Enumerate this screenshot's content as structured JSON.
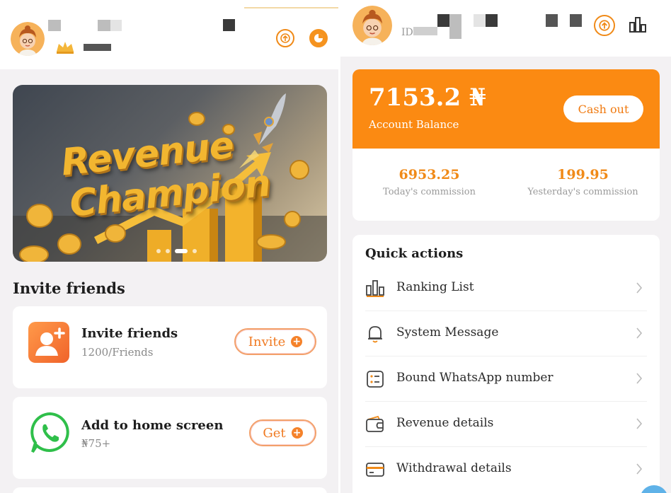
{
  "left": {
    "banner": {
      "line1": "Revenue",
      "line2": "Champion",
      "slide_count": 4,
      "active_slide": 3
    },
    "section_title": "Invite friends",
    "cards": [
      {
        "title": "Invite friends",
        "subtitle": "1200/Friends",
        "button": "Invite",
        "icon": "add-user-icon"
      },
      {
        "title": "Add to home screen",
        "subtitle": "₦75+",
        "button": "Get",
        "icon": "whatsapp-icon"
      }
    ]
  },
  "right": {
    "header": {
      "id_label": "ID:1"
    },
    "balance": {
      "amount": "7153.2 ₦",
      "label": "Account Balance",
      "cashout": "Cash out"
    },
    "stats": [
      {
        "value": "6953.25",
        "label": "Today's commission"
      },
      {
        "value": "199.95",
        "label": "Yesterday's commission"
      }
    ],
    "quick_actions": {
      "title": "Quick actions",
      "items": [
        {
          "label": "Ranking List",
          "icon": "ranking-icon"
        },
        {
          "label": "System Message",
          "icon": "bell-icon"
        },
        {
          "label": "Bound WhatsApp number",
          "icon": "list-icon"
        },
        {
          "label": "Revenue details",
          "icon": "wallet-icon"
        },
        {
          "label": "Withdrawal details",
          "icon": "card-icon"
        }
      ]
    }
  },
  "colors": {
    "accent": "#fb8a12",
    "accent_text": "#f08a18",
    "background": "#f3f1f3",
    "whatsapp": "#2fbf4a"
  }
}
